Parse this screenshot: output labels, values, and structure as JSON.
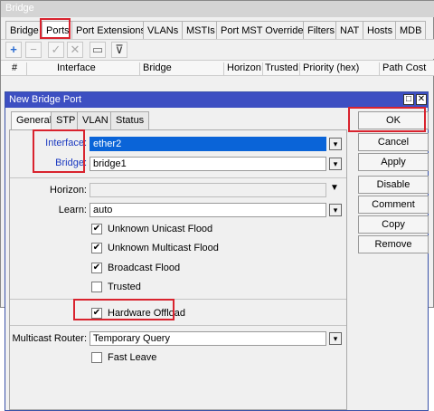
{
  "bg_window": {
    "title": "Bridge",
    "tabs": [
      "Bridge",
      "Ports",
      "Port Extensions",
      "VLANs",
      "MSTIs",
      "Port MST Overrides",
      "Filters",
      "NAT",
      "Hosts",
      "MDB"
    ],
    "columns": [
      "#",
      "Interface",
      "Bridge",
      "Horizon",
      "Trusted",
      "Priority (hex)",
      "Path Cost"
    ]
  },
  "dialog": {
    "title": "New Bridge Port",
    "tabs": [
      "General",
      "STP",
      "VLAN",
      "Status"
    ],
    "fields": {
      "interface_label": "Interface:",
      "interface_value": "ether2",
      "bridge_label": "Bridge:",
      "bridge_value": "bridge1",
      "horizon_label": "Horizon:",
      "horizon_value": "",
      "learn_label": "Learn:",
      "learn_value": "auto",
      "multicast_router_label": "Multicast Router:",
      "multicast_router_value": "Temporary Query"
    },
    "checkboxes": {
      "unknown_unicast_flood": "Unknown Unicast Flood",
      "unknown_multicast_flood": "Unknown Multicast Flood",
      "broadcast_flood": "Broadcast Flood",
      "trusted": "Trusted",
      "hardware_offload": "Hardware Offload",
      "fast_leave": "Fast Leave"
    },
    "buttons": {
      "ok": "OK",
      "cancel": "Cancel",
      "apply": "Apply",
      "disable": "Disable",
      "comment": "Comment",
      "copy": "Copy",
      "remove": "Remove"
    }
  },
  "colors": {
    "dialog_title": "#3d4fc2",
    "highlight_box": "#d9232e",
    "field_label_blue": "#1a39c0",
    "selected_field": "#0a64d8"
  }
}
